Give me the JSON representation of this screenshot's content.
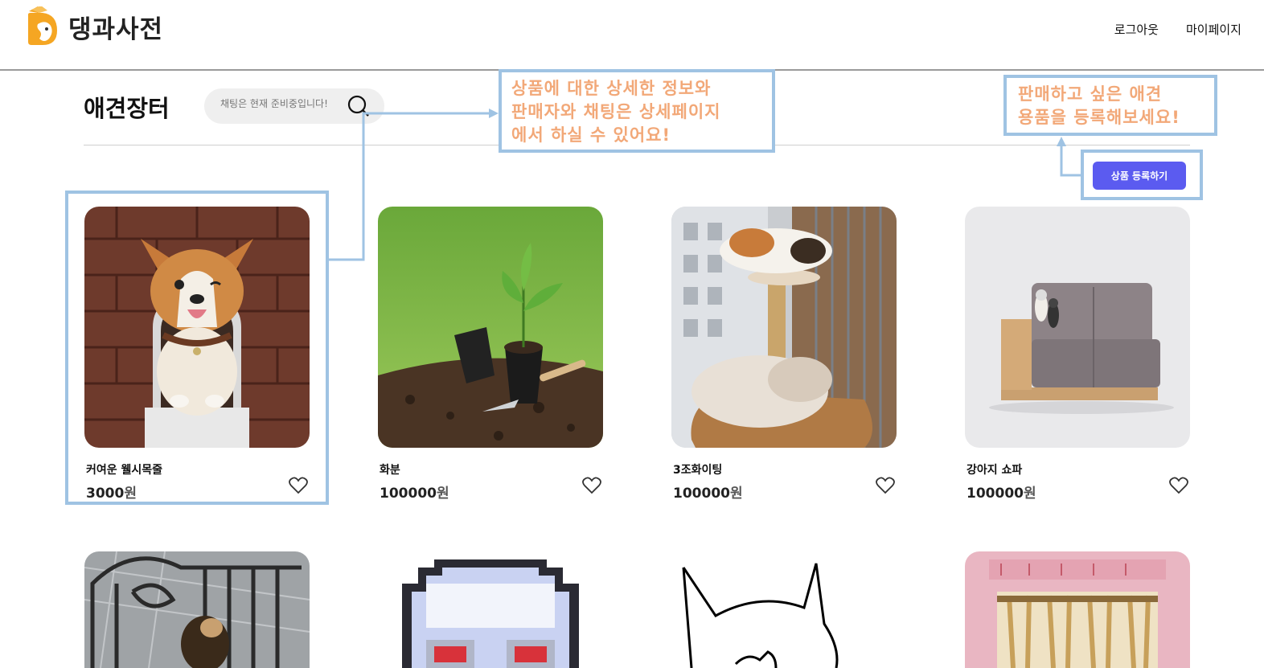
{
  "header": {
    "logo_text": "댕과사전",
    "nav": [
      "로그아웃",
      "마이페이지"
    ]
  },
  "market": {
    "title": "애견장터",
    "search_placeholder": "채팅은 현재 준비중입니다!",
    "register_button": "상품 등록하기"
  },
  "annotations": {
    "detail_note": [
      "상품에 대한 상세한 정보와",
      "판매자와 채팅은 상세페이지",
      "에서 하실 수 있어요!"
    ],
    "register_note": [
      "판매하고 싶은 애견",
      "용품을 등록해보세요!"
    ],
    "note_color": "#f2a878",
    "frame_color": "#9fc3e3"
  },
  "products": [
    {
      "name": "커여운 웰시목줄",
      "price": "3000",
      "currency": "원",
      "image": "corgi-in-mailbox"
    },
    {
      "name": "화분",
      "price": "100000",
      "currency": "원",
      "image": "sapling-in-pot"
    },
    {
      "name": "3조화이팅",
      "price": "100000",
      "currency": "원",
      "image": "cats-on-cat-tower"
    },
    {
      "name": "강아지 쇼파",
      "price": "100000",
      "currency": "원",
      "image": "dogs-on-sofa"
    }
  ],
  "products_row2_images": [
    "puppy-behind-fence",
    "pixel-ghost",
    "cat-doodle",
    "ginseng-box"
  ],
  "colors": {
    "accent": "#5b5bf0",
    "logo_orange": "#f5a623"
  }
}
